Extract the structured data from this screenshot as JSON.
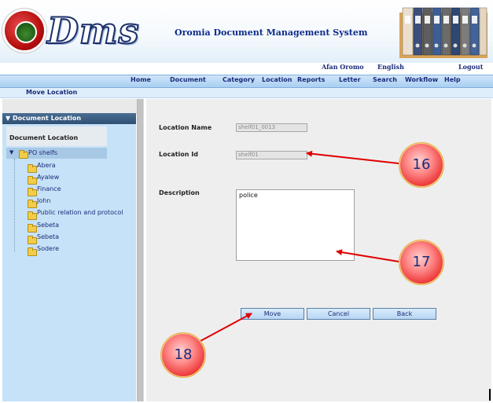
{
  "header": {
    "logo_text": "Dms",
    "app_title": "Oromia Document Management System",
    "links": {
      "afan_oromo": "Afan Oromo",
      "english": "English",
      "logout": "Logout"
    }
  },
  "nav": {
    "items": [
      "Home",
      "Document",
      "Category",
      "Location",
      "Reports",
      "Letter",
      "Search",
      "Workflow",
      "Help"
    ],
    "subtitle": "Move Location"
  },
  "sidebar": {
    "header": "Document Location",
    "tree_title": "Document Location",
    "root": "PO shelfs",
    "items": [
      "Abera",
      "Ayalew",
      "Finance",
      "John",
      "Public relation and protocol",
      "Sebeta",
      "Sebeta",
      "Sodere"
    ]
  },
  "form": {
    "location_name_label": "Location Name",
    "location_name_value": "shelf01_0013",
    "location_id_label": "Location Id",
    "location_id_value": "shelf01",
    "description_label": "Description",
    "description_value": "police",
    "buttons": {
      "move": "Move",
      "cancel": "Cancel",
      "back": "Back"
    }
  },
  "callouts": [
    "16",
    "17",
    "18"
  ],
  "colors": {
    "accent": "#1a2c7a",
    "nav_bar": "#a9cff1",
    "callout": "#ea2f2f",
    "arrow": "#e00000"
  }
}
